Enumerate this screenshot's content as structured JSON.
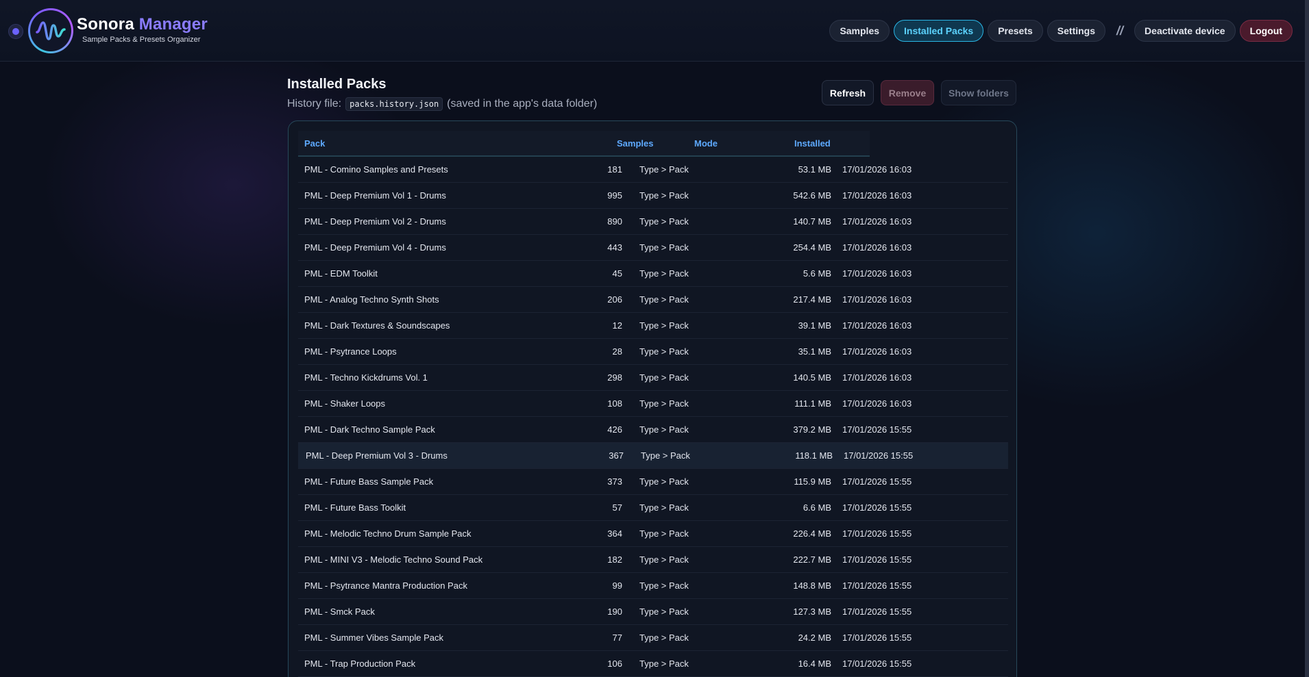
{
  "app": {
    "title_part1": "Sonora",
    "title_part2": "Manager",
    "subtitle": "Sample Packs & Presets Organizer",
    "accent_color": "#8a7cff"
  },
  "nav": {
    "items": [
      {
        "label": "Samples"
      },
      {
        "label": "Installed Packs",
        "active": true
      },
      {
        "label": "Presets"
      },
      {
        "label": "Settings"
      }
    ],
    "separator": "//",
    "deactivate_label": "Deactivate device",
    "logout_label": "Logout"
  },
  "page": {
    "title": "Installed Packs",
    "history_prefix": "History file:",
    "history_file": "packs.history.json",
    "history_suffix": "(saved in the app's data folder)"
  },
  "actions": {
    "refresh_label": "Refresh",
    "remove_label": "Remove",
    "show_folders_label": "Show folders"
  },
  "table": {
    "columns": [
      "Pack",
      "Samples",
      "Mode",
      "Installed"
    ],
    "rows": [
      {
        "pack": "PML - Comino Samples and Presets",
        "samples": "181",
        "mode": "Type > Pack",
        "size": "53.1 MB",
        "installed": "17/01/2026 16:03"
      },
      {
        "pack": "PML - Deep Premium Vol 1 - Drums",
        "samples": "995",
        "mode": "Type > Pack",
        "size": "542.6 MB",
        "installed": "17/01/2026 16:03"
      },
      {
        "pack": "PML - Deep Premium Vol 2 - Drums",
        "samples": "890",
        "mode": "Type > Pack",
        "size": "140.7 MB",
        "installed": "17/01/2026 16:03"
      },
      {
        "pack": "PML - Deep Premium Vol 4 - Drums",
        "samples": "443",
        "mode": "Type > Pack",
        "size": "254.4 MB",
        "installed": "17/01/2026 16:03"
      },
      {
        "pack": "PML - EDM Toolkit",
        "samples": "45",
        "mode": "Type > Pack",
        "size": "5.6 MB",
        "installed": "17/01/2026 16:03"
      },
      {
        "pack": "PML - Analog Techno Synth Shots",
        "samples": "206",
        "mode": "Type > Pack",
        "size": "217.4 MB",
        "installed": "17/01/2026 16:03"
      },
      {
        "pack": "PML - Dark Textures & Soundscapes",
        "samples": "12",
        "mode": "Type > Pack",
        "size": "39.1 MB",
        "installed": "17/01/2026 16:03"
      },
      {
        "pack": "PML - Psytrance Loops",
        "samples": "28",
        "mode": "Type > Pack",
        "size": "35.1 MB",
        "installed": "17/01/2026 16:03"
      },
      {
        "pack": "PML - Techno Kickdrums Vol. 1",
        "samples": "298",
        "mode": "Type > Pack",
        "size": "140.5 MB",
        "installed": "17/01/2026 16:03"
      },
      {
        "pack": "PML - Shaker Loops",
        "samples": "108",
        "mode": "Type > Pack",
        "size": "111.1 MB",
        "installed": "17/01/2026 16:03"
      },
      {
        "pack": "PML - Dark Techno Sample Pack",
        "samples": "426",
        "mode": "Type > Pack",
        "size": "379.2 MB",
        "installed": "17/01/2026 15:55"
      },
      {
        "pack": "PML - Deep Premium Vol 3 - Drums",
        "samples": "367",
        "mode": "Type > Pack",
        "size": "118.1 MB",
        "installed": "17/01/2026 15:55",
        "highlighted": true
      },
      {
        "pack": "PML - Future Bass Sample Pack",
        "samples": "373",
        "mode": "Type > Pack",
        "size": "115.9 MB",
        "installed": "17/01/2026 15:55"
      },
      {
        "pack": "PML - Future Bass Toolkit",
        "samples": "57",
        "mode": "Type > Pack",
        "size": "6.6 MB",
        "installed": "17/01/2026 15:55"
      },
      {
        "pack": "PML - Melodic Techno Drum Sample Pack",
        "samples": "364",
        "mode": "Type > Pack",
        "size": "226.4 MB",
        "installed": "17/01/2026 15:55"
      },
      {
        "pack": "PML - MINI V3 - Melodic Techno Sound Pack",
        "samples": "182",
        "mode": "Type > Pack",
        "size": "222.7 MB",
        "installed": "17/01/2026 15:55"
      },
      {
        "pack": "PML - Psytrance Mantra Production Pack",
        "samples": "99",
        "mode": "Type > Pack",
        "size": "148.8 MB",
        "installed": "17/01/2026 15:55"
      },
      {
        "pack": "PML - Smck Pack",
        "samples": "190",
        "mode": "Type > Pack",
        "size": "127.3 MB",
        "installed": "17/01/2026 15:55"
      },
      {
        "pack": "PML - Summer Vibes Sample Pack",
        "samples": "77",
        "mode": "Type > Pack",
        "size": "24.2 MB",
        "installed": "17/01/2026 15:55"
      },
      {
        "pack": "PML - Trap Production Pack",
        "samples": "106",
        "mode": "Type > Pack",
        "size": "16.4 MB",
        "installed": "17/01/2026 15:55"
      }
    ]
  }
}
